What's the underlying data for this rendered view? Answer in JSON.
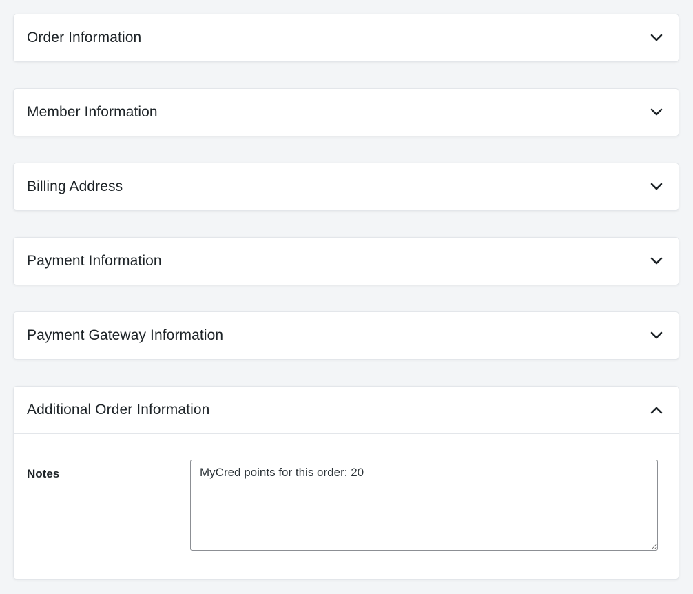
{
  "panels": [
    {
      "title": "Order Information",
      "expanded": false,
      "icon": "chevron-down-icon"
    },
    {
      "title": "Member Information",
      "expanded": false,
      "icon": "chevron-down-icon"
    },
    {
      "title": "Billing Address",
      "expanded": false,
      "icon": "chevron-down-icon"
    },
    {
      "title": "Payment Information",
      "expanded": false,
      "icon": "chevron-down-icon"
    },
    {
      "title": "Payment Gateway Information",
      "expanded": false,
      "icon": "chevron-down-icon"
    },
    {
      "title": "Additional Order Information",
      "expanded": true,
      "icon": "chevron-up-icon"
    }
  ],
  "notes": {
    "label": "Notes",
    "value": "MyCred points for this order: 20"
  }
}
